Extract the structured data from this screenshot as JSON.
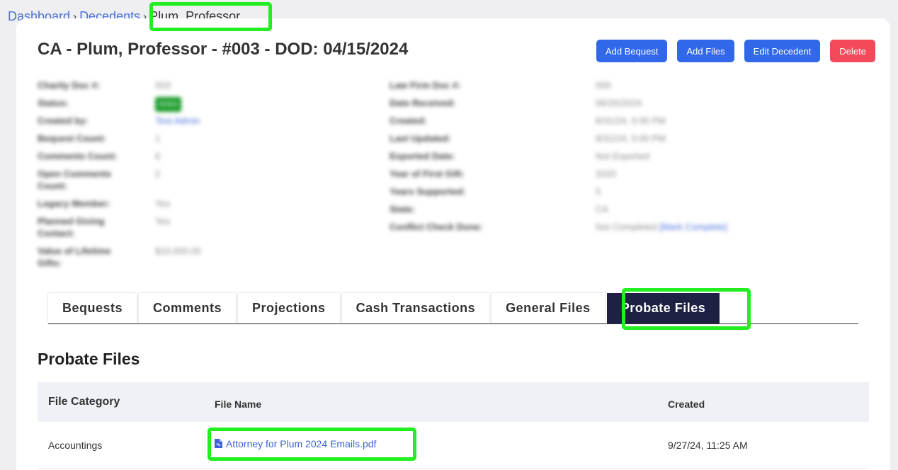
{
  "breadcrumb": {
    "items": [
      "Dashboard",
      "Decedents"
    ],
    "separator": "›",
    "current": "Plum, Professor"
  },
  "page": {
    "title": "CA - Plum, Professor - #003 - DOD: 04/15/2024"
  },
  "actions": {
    "add_bequest": "Add Bequest",
    "add_files": "Add Files",
    "edit_decedent": "Edit Decedent",
    "delete": "Delete"
  },
  "details_left": [
    {
      "label": "Charity Doc #:",
      "value": "003"
    },
    {
      "label": "Status:",
      "value": "Active"
    },
    {
      "label": "Created by:",
      "value": "Test Admin"
    },
    {
      "label": "Bequest Count:",
      "value": "1"
    },
    {
      "label": "Comments Count:",
      "value": "6"
    },
    {
      "label": "Open Comments Count:",
      "value": "2"
    },
    {
      "label": "Legacy Member:",
      "value": "Yes"
    },
    {
      "label": "Planned Giving Contact:",
      "value": "Yes"
    },
    {
      "label": "Value of Lifetime Gifts:",
      "value": "$10,000.00"
    }
  ],
  "details_right": [
    {
      "label": "Law Firm Doc #:",
      "value": "000"
    },
    {
      "label": "Date Received:",
      "value": "06/20/2024"
    },
    {
      "label": "Created:",
      "value": "8/31/24, 5:00 PM"
    },
    {
      "label": "Last Updated:",
      "value": "8/31/24, 5:00 PM"
    },
    {
      "label": "Exported Date:",
      "value": "Not Exported"
    },
    {
      "label": "Year of First Gift:",
      "value": "2020"
    },
    {
      "label": "Years Supported:",
      "value": "5"
    },
    {
      "label": "State:",
      "value": "CA"
    },
    {
      "label": "Conflict Check Done:",
      "value": "Not Completed",
      "link": "[Mark Complete]"
    }
  ],
  "tabs": [
    "Bequests",
    "Comments",
    "Projections",
    "Cash Transactions",
    "General Files",
    "Probate Files"
  ],
  "active_tab": "Probate Files",
  "section": {
    "title": "Probate Files"
  },
  "table": {
    "headers": {
      "category": "File Category",
      "name": "File Name",
      "created": "Created"
    },
    "rows": [
      {
        "category": "Accountings",
        "file_name": "Attorney for Plum 2024 Emails.pdf",
        "file_icon": "pdf-file-icon",
        "created": "9/27/24, 11:25 AM"
      }
    ]
  },
  "colors": {
    "primary": "#3068e9",
    "danger": "#f4495b",
    "active_tab": "#1e2044",
    "link": "#4a6fdc",
    "highlight": "#22ee22"
  }
}
